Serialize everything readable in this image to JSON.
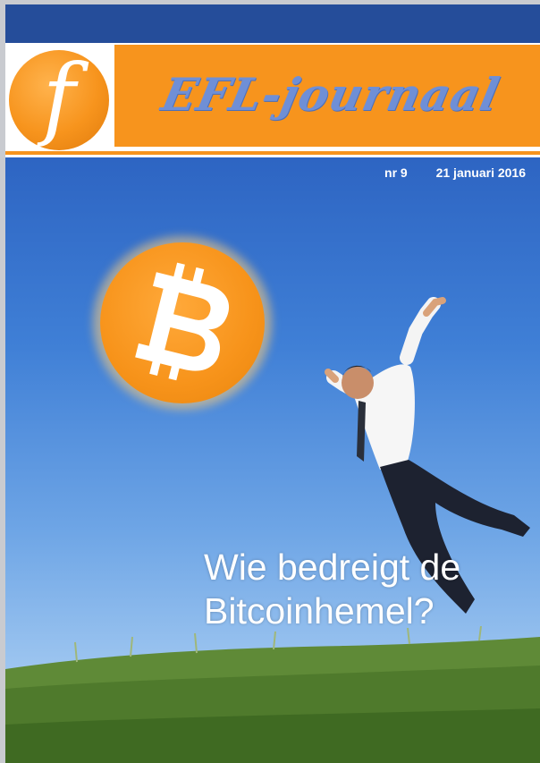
{
  "masthead": {
    "logo_letter": "f",
    "title": "EFL-journaal"
  },
  "issue": {
    "number": "nr 9",
    "date": "21 januari  2016"
  },
  "headline": {
    "line1": "Wie bedreigt de",
    "line2": "Bitcoinhemel?"
  },
  "colors": {
    "brand_orange": "#f7941d",
    "brand_blue": "#254d9a",
    "masthead_text": "#6f8fd6",
    "bitcoin_orange": "#f7931a"
  },
  "icons": {
    "logo": "f-logo-icon",
    "bitcoin": "bitcoin-icon"
  }
}
